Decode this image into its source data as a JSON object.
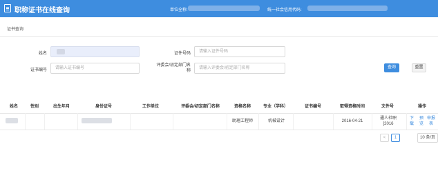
{
  "header": {
    "title": "职称证书在线查询",
    "unit_label": "单位全称:",
    "credit_label": "统一社会信用代码:",
    "bg_color": "#3e8ddf"
  },
  "section": {
    "title": "证书查询"
  },
  "form": {
    "name_label": "姓名",
    "cert_no_label": "证件号码",
    "cert_no_placeholder": "请输入证件号码",
    "cert_code_label": "证书编号",
    "cert_code_placeholder": "请输入证书编号",
    "committee_label_line1": "评委会/初定部门名",
    "committee_label_line2": "称",
    "committee_placeholder": "请输入评委会/初定部门名称",
    "query_button": "查询",
    "reset_button": "重置"
  },
  "table": {
    "columns": [
      "姓名",
      "性别",
      "出生年月",
      "身份证号",
      "工作单位",
      "评委会/初定部门名称",
      "资格名称",
      "专业（学科）",
      "证书编号",
      "取得资格时间",
      "文件号",
      "操作"
    ],
    "rows": [
      {
        "qualification": "助理工程师",
        "major": "机械设计",
        "date": "2016-04-21",
        "doc_no_line1": "通人社职",
        "doc_no_line2": "[2016",
        "ops": [
          [
            "下",
            "载"
          ],
          [
            "预",
            "览"
          ],
          [
            "申报",
            "表"
          ]
        ]
      }
    ]
  },
  "pagination": {
    "prev": "<",
    "current_page": "1",
    "next": ">",
    "page_size": "10 条/页"
  }
}
